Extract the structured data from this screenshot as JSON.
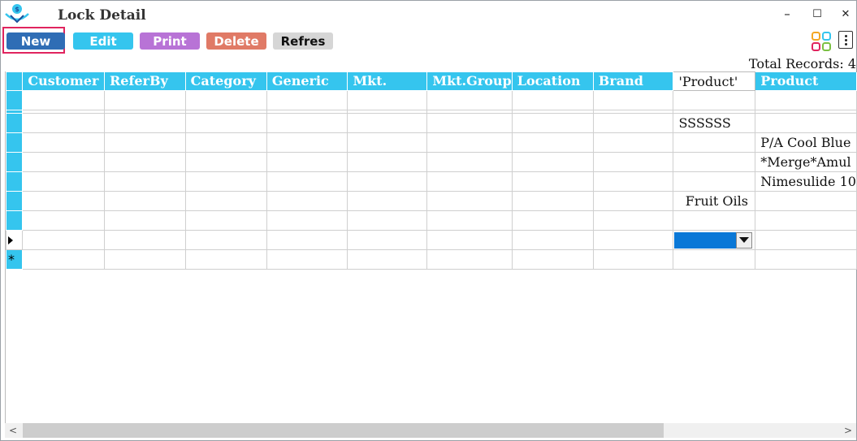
{
  "window": {
    "title": "Lock Detail",
    "minimize": "–",
    "maximize": "☐",
    "close": "✕"
  },
  "toolbar": {
    "new_label": "New",
    "edit_label": "Edit",
    "print_label": "Print",
    "delete_label": "Delete",
    "refresh_label": "Refres",
    "colors": {
      "new": "#2f6db5",
      "edit": "#35c5ee",
      "print": "#b873d6",
      "delete": "#e07a66",
      "refresh": "#d6d6d6",
      "highlight": "#e0245e"
    }
  },
  "total_records": "Total Records: 4",
  "grid": {
    "columns": [
      "Customer",
      "ReferBy",
      "Category",
      "Generic",
      "Mkt.",
      "Mkt.Group",
      "Location",
      "Brand",
      "'Product'",
      "Product"
    ],
    "rows": [
      [
        "",
        "",
        "",
        "",
        "",
        "",
        "",
        "",
        "",
        ""
      ],
      [
        "",
        "",
        "",
        "",
        "",
        "",
        "",
        "",
        "SSSSSS",
        ""
      ],
      [
        "",
        "",
        "",
        "",
        "",
        "",
        "",
        "",
        "",
        "P/A Cool Blue"
      ],
      [
        "",
        "",
        "",
        "",
        "",
        "",
        "",
        "",
        "",
        "*Merge*Amul"
      ],
      [
        "",
        "",
        "",
        "",
        "",
        "",
        "",
        "",
        "",
        "Nimesulide 10"
      ],
      [
        "",
        "",
        "",
        "",
        "",
        "",
        "",
        "",
        "Fruit Oils",
        ""
      ],
      [
        "",
        "",
        "",
        "",
        "",
        "",
        "",
        "",
        "",
        ""
      ]
    ],
    "new_row_marker": "*"
  },
  "scrollbar": {
    "left_arrow": "<",
    "right_arrow": ">"
  }
}
